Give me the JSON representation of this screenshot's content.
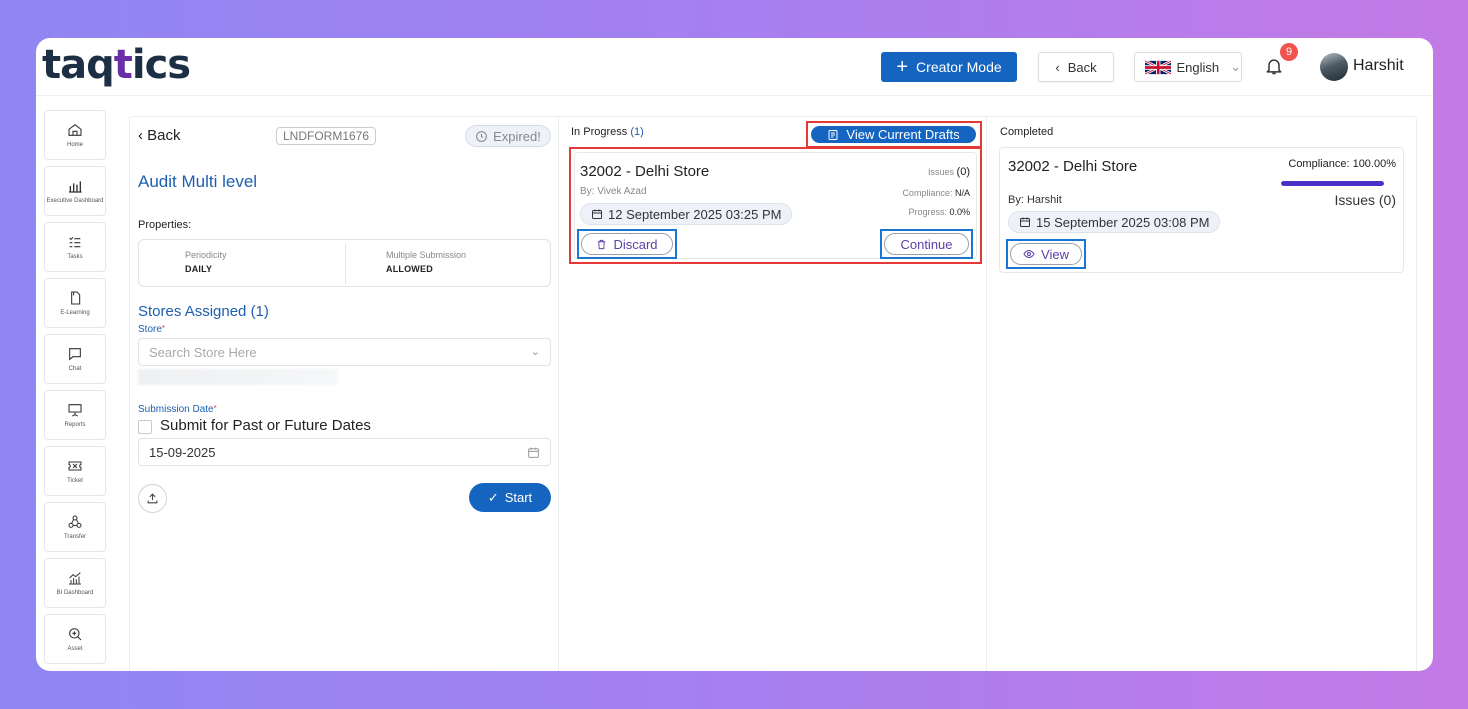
{
  "app": {
    "logo_left": "taq",
    "logo_q": "t",
    "logo_right": "ics"
  },
  "header": {
    "creator_mode": "Creator Mode",
    "back": "Back",
    "language": "English",
    "notification_count": "9",
    "user_name": "Harshit"
  },
  "sidebar": {
    "items": [
      {
        "label": "Home",
        "icon": "home-icon"
      },
      {
        "label": "Executive Dashboard",
        "icon": "bar-chart-icon"
      },
      {
        "label": "Tasks",
        "icon": "checklist-icon"
      },
      {
        "label": "E-Learning",
        "icon": "document-icon"
      },
      {
        "label": "Chat",
        "icon": "chat-icon"
      },
      {
        "label": "Reports",
        "icon": "presentation-icon"
      },
      {
        "label": "Ticket",
        "icon": "ticket-icon"
      },
      {
        "label": "Transfer",
        "icon": "transfer-icon"
      },
      {
        "label": "BI Dashboard",
        "icon": "analytics-icon"
      },
      {
        "label": "Asset",
        "icon": "asset-icon"
      }
    ]
  },
  "form": {
    "back": "Back",
    "code": "LNDFORM1676",
    "status": "Expired!",
    "title": "Audit Multi level",
    "properties_label": "Properties:",
    "periodicity_label": "Periodicity",
    "periodicity_value": "DAILY",
    "multiple_label": "Multiple Submission",
    "multiple_value": "ALLOWED",
    "stores_title": "Stores Assigned (1)",
    "store_label": "Store",
    "store_placeholder": "Search Store Here",
    "submission_label": "Submission Date",
    "past_future_label": "Submit for Past or Future Dates",
    "date_value": "15-09-2025",
    "start": "Start"
  },
  "in_progress": {
    "label": "In Progress",
    "count": "(1)",
    "drafts_button": "View Current Drafts",
    "card": {
      "store": "32002 - Delhi Store",
      "by": "By: Vivek Azad",
      "date": "12 September 2025 03:25 PM",
      "issues_label": "Issues",
      "issues_value": "(0)",
      "compliance_label": "Compliance:",
      "compliance_value": "N/A",
      "progress_label": "Progress:",
      "progress_value": "0.0%",
      "discard": "Discard",
      "continue": "Continue"
    }
  },
  "completed": {
    "label": "Completed",
    "card": {
      "store": "32002 - Delhi Store",
      "compliance": "Compliance: 100.00%",
      "compliance_fraction": 1.0,
      "by": "By: Harshit",
      "issues": "Issues (0)",
      "date": "15 September 2025 03:08 PM",
      "view": "View"
    }
  },
  "colors": {
    "primary": "#1565c0",
    "highlight_red": "#e53935",
    "highlight_blue": "#1976d2",
    "progress": "#4a32c9"
  }
}
